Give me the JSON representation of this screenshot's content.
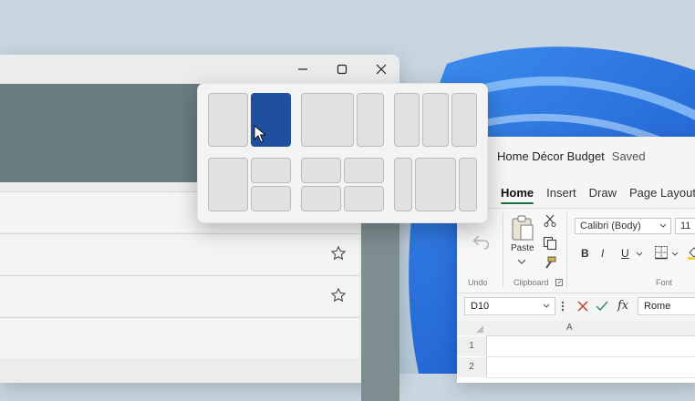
{
  "snap_layouts": {
    "active_zone": "two-column-right"
  },
  "excel": {
    "doc_title": "Home Décor Budget",
    "doc_status": "Saved",
    "tabs": [
      "Home",
      "Insert",
      "Draw",
      "Page Layout"
    ],
    "groups": {
      "undo_label": "Undo",
      "clipboard_label": "Clipboard",
      "font_label": "Font",
      "paste_label": "Paste"
    },
    "font_name": "Calibri (Body)",
    "font_size": "11",
    "format_buttons": [
      "B",
      "I",
      "U"
    ],
    "name_box": "D10",
    "formula_value": "Rome",
    "fx_label": "fx",
    "column_header": "A",
    "row_numbers": [
      "1",
      "2"
    ]
  },
  "accent": {
    "snap_active": "#1f4f9e",
    "excel_green": "#1e7145"
  }
}
